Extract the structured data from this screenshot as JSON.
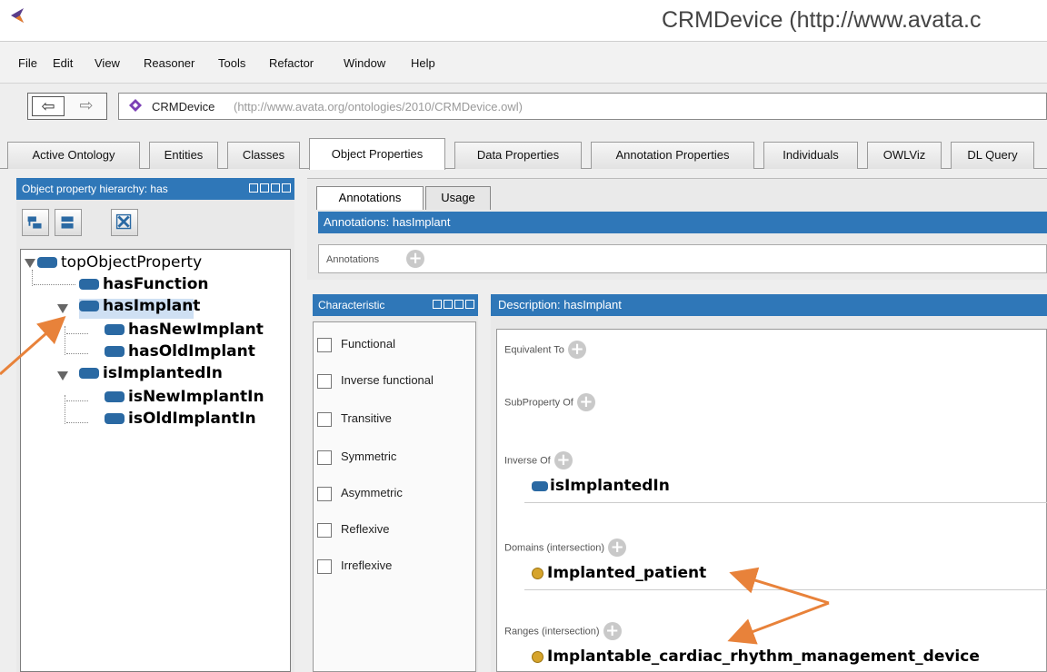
{
  "window": {
    "title": "CRMDevice (http://www.avata.c"
  },
  "menu": [
    "File",
    "Edit",
    "View",
    "Reasoner",
    "Tools",
    "Refactor",
    "Window",
    "Help"
  ],
  "nav": {
    "back": "⇦",
    "forward": "⇨"
  },
  "ontology": {
    "name": "CRMDevice",
    "url": "(http://www.avata.org/ontologies/2010/CRMDevice.owl)"
  },
  "tabs": [
    "Active Ontology",
    "Entities",
    "Classes",
    "Object Properties",
    "Data Properties",
    "Annotation Properties",
    "Individuals",
    "OWLViz",
    "DL Query"
  ],
  "active_tab": "Object Properties",
  "hierarchy": {
    "title": "Object property hierarchy: has",
    "nodes": [
      "topObjectProperty",
      "hasFunction",
      "hasImplant",
      "hasNewImplant",
      "hasOldImplant",
      "isImplantedIn",
      "isNewImplantIn",
      "isOldImplantIn"
    ],
    "selected": "hasImplant"
  },
  "annotations_panel": {
    "tabs": [
      "Annotations",
      "Usage"
    ],
    "header": "Annotations: hasImplant",
    "label": "Annotations"
  },
  "characteristics": {
    "title": "Characteristic",
    "items": [
      "Functional",
      "Inverse functional",
      "Transitive",
      "Symmetric",
      "Asymmetric",
      "Reflexive",
      "Irreflexive"
    ]
  },
  "description": {
    "header": "Description: hasImplant",
    "equivalent_to": "Equivalent To",
    "subproperty_of": "SubProperty Of",
    "inverse_of": "Inverse Of",
    "inverse_value": "isImplantedIn",
    "domains": "Domains (intersection)",
    "domain_value": "Implanted_patient",
    "ranges": "Ranges (intersection)",
    "range_value": "Implantable_cardiac_rhythm_management_device"
  },
  "colors": {
    "header_blue": "#2f77b8",
    "property_blue": "#2a69a3",
    "class_gold": "#d6a42c",
    "arrow_orange": "#e8823a"
  }
}
